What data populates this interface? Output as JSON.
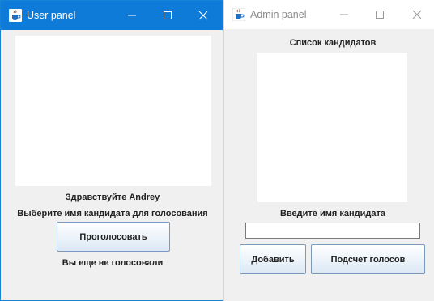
{
  "user_panel": {
    "title": "User panel",
    "greeting": "Здравствуйте Andrey",
    "instruction": "Выберите имя кандидата для голосования",
    "vote_button": "Проголосовать",
    "status": "Вы еще не голосовали",
    "candidates": []
  },
  "admin_panel": {
    "title": "Admin panel",
    "list_header": "Список кандидатов",
    "name_prompt": "Введите имя кандидата",
    "name_input": {
      "value": "",
      "placeholder": ""
    },
    "add_button": "Добавить",
    "count_button": "Подсчет голосов",
    "candidates": []
  },
  "colors": {
    "active_titlebar": "#0e7bd8",
    "inactive_titlebar": "#ffffff",
    "window_background": "#f0f0f0",
    "button_border": "#7a99bb"
  },
  "icons": {
    "app": "java-cup-icon",
    "minimize": "minimize-icon",
    "maximize": "maximize-icon",
    "close": "close-icon"
  }
}
